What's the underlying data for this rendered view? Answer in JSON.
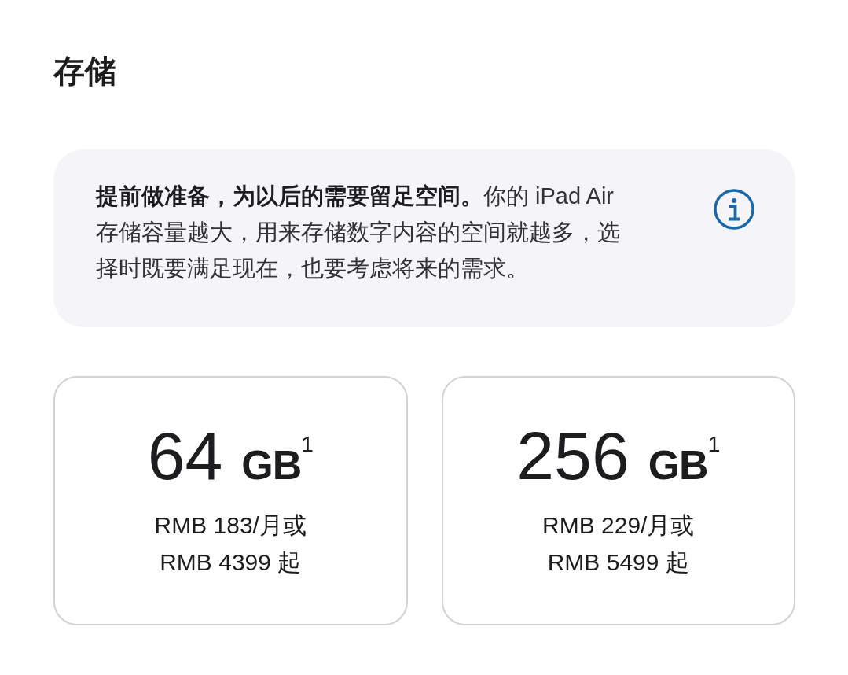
{
  "title": "存储",
  "notice": {
    "text": "**提前做准备，为以后的需要留足空间。**你的 iPad Air 存储容量越大，用来存储数字内容的空间就越多，选择时既要满足现在，也要考虑将来的需求。"
  },
  "options": [
    {
      "capacity": "64 **GB**$^{1}$",
      "prices": [
        "RMB 183/月或",
        "RMB 4399 起"
      ],
      "selected": false
    },
    {
      "capacity": "256 **GB**$^{1}$",
      "prices": [
        "RMB 229/月或",
        "RMB 5499 起"
      ],
      "selected": false
    }
  ]
}
